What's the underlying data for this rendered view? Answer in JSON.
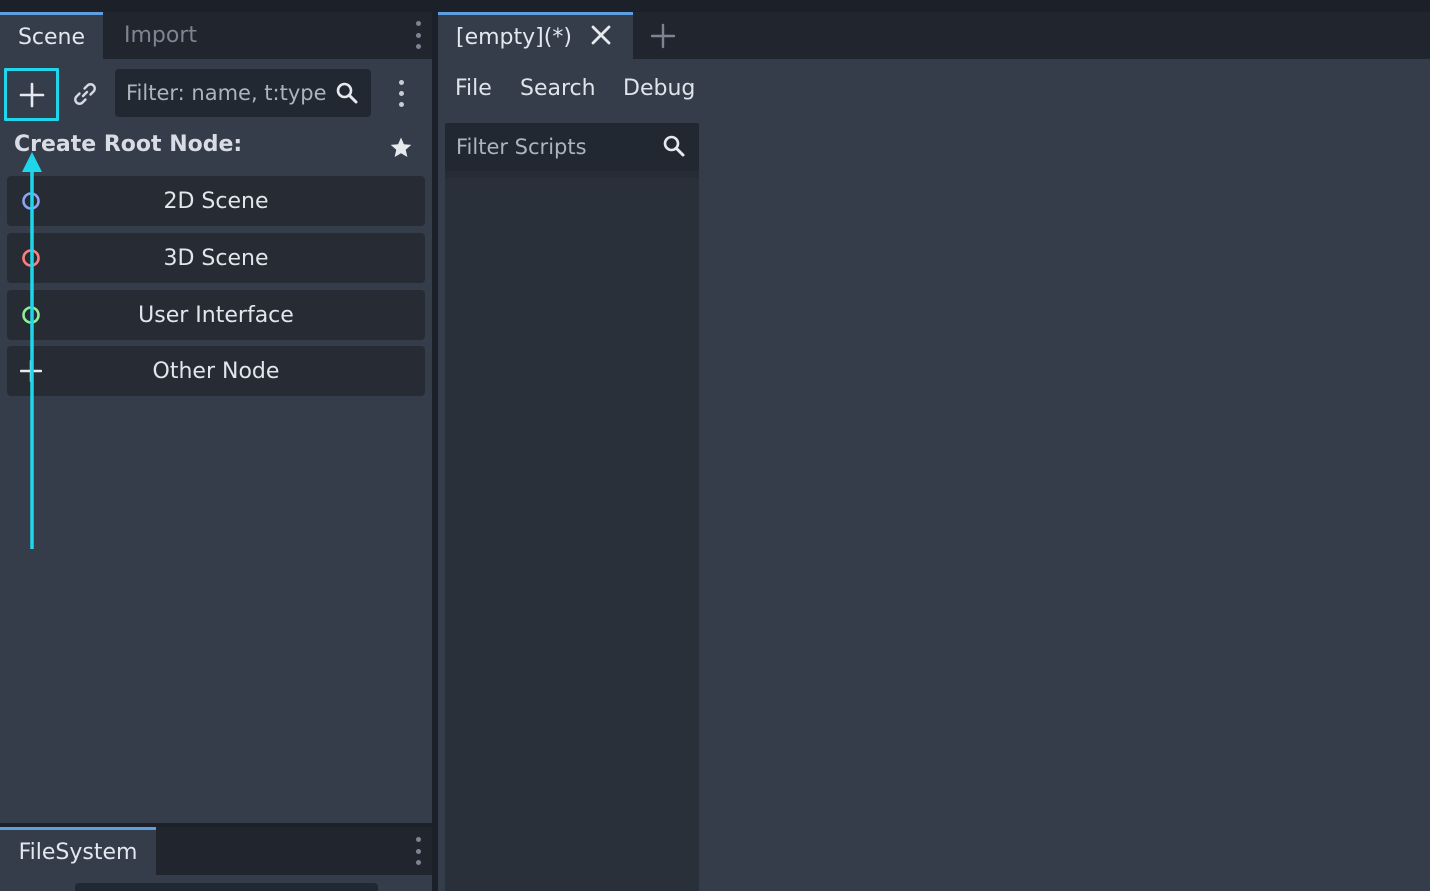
{
  "colors": {
    "accent": "#5f9fe0",
    "highlight": "#1fd6ea",
    "panel_bg": "#363d4a",
    "tabbar_bg": "#21262e",
    "button_bg": "#262b34",
    "node_2d": "#8da5f3",
    "node_3d": "#fc7f7f",
    "node_ui": "#8eef97"
  },
  "scene_dock": {
    "tabs": [
      {
        "label": "Scene",
        "active": true
      },
      {
        "label": "Import",
        "active": false
      }
    ],
    "toolbar": {
      "add_icon": "plus-icon",
      "link_icon": "chain-link-icon",
      "filter_placeholder": "Filter: name, t:type",
      "search_icon": "search-icon",
      "menu_icon": "kebab-menu-icon"
    },
    "create_root_label": "Create Root Node:",
    "favorite_icon": "star-icon",
    "root_node_options": [
      {
        "label": "2D Scene",
        "icon": "node2d-icon"
      },
      {
        "label": "3D Scene",
        "icon": "node3d-icon"
      },
      {
        "label": "User Interface",
        "icon": "control-icon"
      },
      {
        "label": "Other Node",
        "icon": "plus-icon"
      }
    ]
  },
  "filesystem_dock": {
    "tab_label": "FileSystem"
  },
  "script_editor": {
    "tab_label": "[empty](*)",
    "close_icon": "close-icon",
    "new_tab_icon": "plus-icon",
    "menu": [
      "File",
      "Search",
      "Debug"
    ],
    "filter_placeholder": "Filter Scripts",
    "search_icon": "search-icon"
  }
}
